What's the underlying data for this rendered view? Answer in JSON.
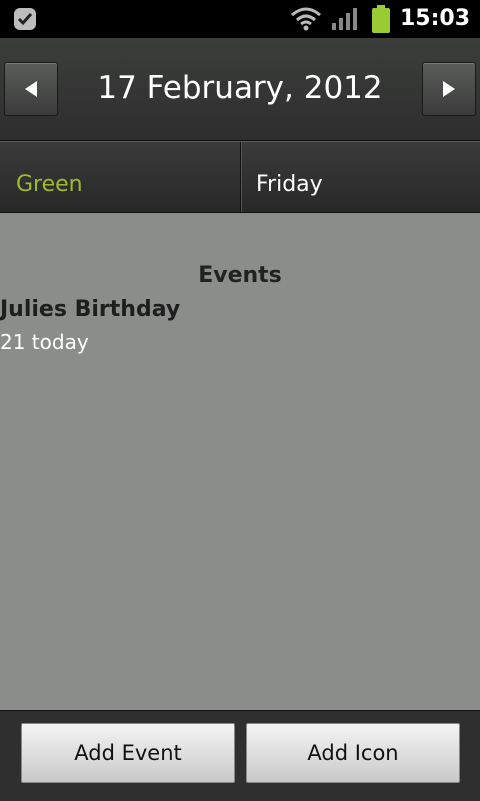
{
  "status_bar": {
    "time": "15:03",
    "icons": [
      "app-notification-icon",
      "wifi-icon",
      "signal-icon",
      "battery-icon"
    ],
    "battery_color": "#99cc33"
  },
  "header": {
    "date": "17 February, 2012",
    "prev_icon": "left-arrow-icon",
    "next_icon": "right-arrow-icon"
  },
  "info": {
    "color_name": "Green",
    "color_hex": "#9bbd2b",
    "day_name": "Friday"
  },
  "events": {
    "heading": "Events",
    "items": [
      {
        "title": "Julies Birthday",
        "detail": "21 today"
      }
    ]
  },
  "actions": {
    "add_event": "Add Event",
    "add_icon": "Add Icon"
  }
}
